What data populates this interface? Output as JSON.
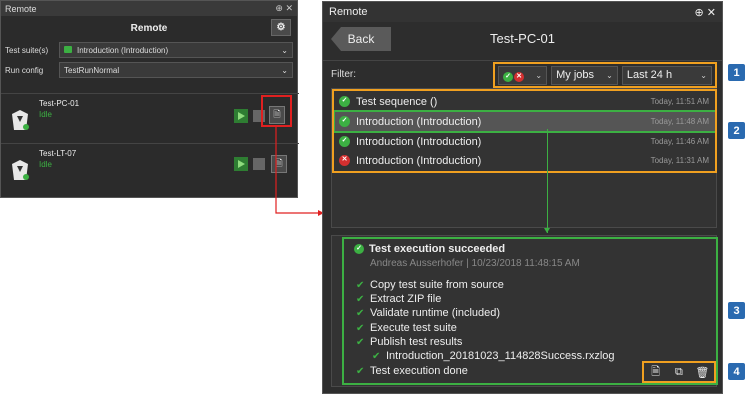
{
  "left": {
    "window_title": "Remote",
    "window_controls": "⊕ ✕",
    "header_title": "Remote",
    "header_icon": "remote-settings-icon",
    "test_suite_label": "Test suite(s)",
    "test_suite_value": "Introduction (Introduction)",
    "run_config_label": "Run config",
    "run_config_value": "TestRunNormal",
    "agents": [
      {
        "name": "Test-PC-01",
        "status": "Idle"
      },
      {
        "name": "Test-LT-07",
        "status": "Idle"
      }
    ]
  },
  "right": {
    "window_title": "Remote",
    "window_controls": "⊕ ✕",
    "back_label": "Back",
    "title": "Test-PC-01",
    "filter_label": "Filter:",
    "filter_jobs": "My jobs",
    "filter_time": "Last 24 h",
    "jobs": [
      {
        "name": "Test sequence ()",
        "time": "Today, 11:51 AM",
        "status": "success"
      },
      {
        "name": "Introduction (Introduction)",
        "time": "Today, 11:48 AM",
        "status": "success"
      },
      {
        "name": "Introduction (Introduction)",
        "time": "Today, 11:46 AM",
        "status": "success"
      },
      {
        "name": "Introduction (Introduction)",
        "time": "Today, 11:31 AM",
        "status": "failed"
      }
    ],
    "details": {
      "headline": "Test execution succeeded",
      "subline": "Andreas Ausserhofer | 10/23/2018 11:48:15 AM",
      "steps": [
        "Copy test suite from source",
        "Extract ZIP file",
        "Validate runtime (included)",
        "Execute test suite",
        "Publish test results",
        "Introduction_20181023_114828Success.rxzlog",
        "Test execution done"
      ]
    }
  },
  "badges": [
    "1",
    "2",
    "3",
    "4"
  ],
  "colors": {
    "success": "#3cb043",
    "error": "#d32f2f",
    "highlight_orange": "#f0a020",
    "highlight_red": "#e02020",
    "badge_blue": "#2a6ab0"
  }
}
